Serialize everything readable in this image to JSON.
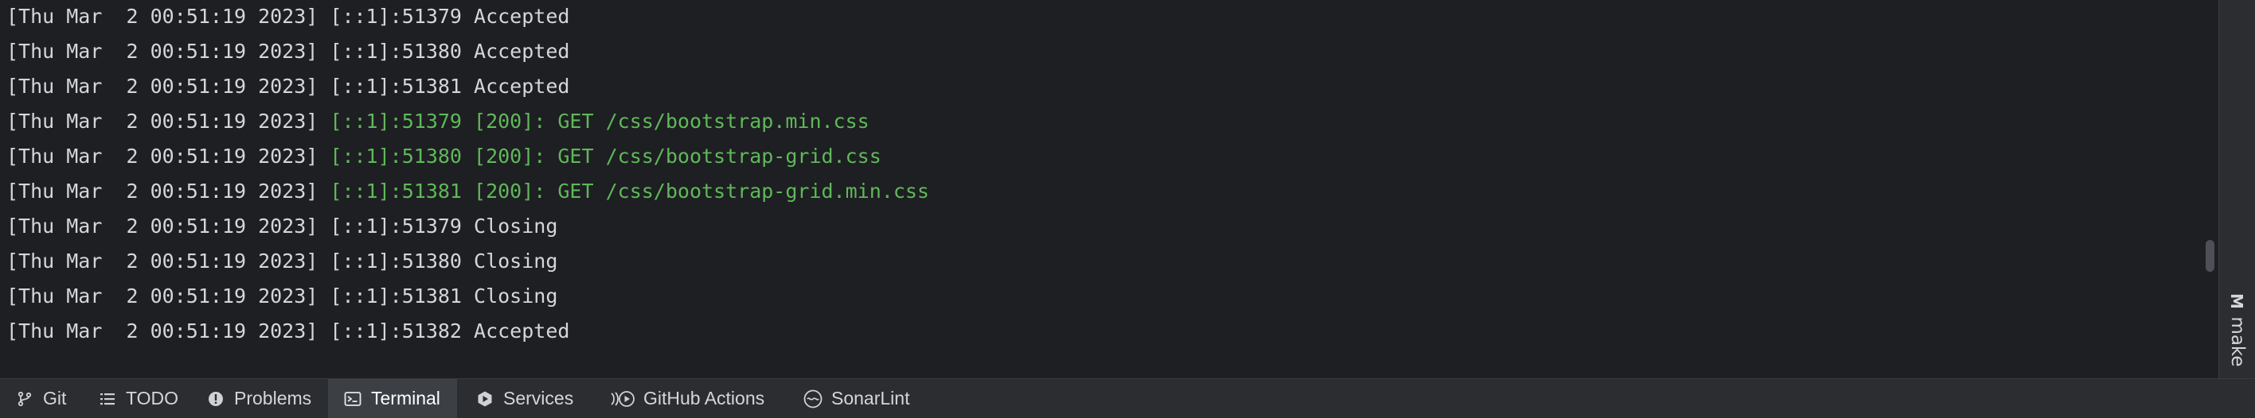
{
  "terminal": {
    "lines": [
      {
        "prefix": "[Thu Mar  2 00:51:19 2023]",
        "message": "[::1]:51379 Accepted",
        "style": "plain"
      },
      {
        "prefix": "[Thu Mar  2 00:51:19 2023]",
        "message": "[::1]:51380 Accepted",
        "style": "plain"
      },
      {
        "prefix": "[Thu Mar  2 00:51:19 2023]",
        "message": "[::1]:51381 Accepted",
        "style": "plain"
      },
      {
        "prefix": "[Thu Mar  2 00:51:19 2023]",
        "message": "[::1]:51379 [200]: GET /css/bootstrap.min.css",
        "style": "green"
      },
      {
        "prefix": "[Thu Mar  2 00:51:19 2023]",
        "message": "[::1]:51380 [200]: GET /css/bootstrap-grid.css",
        "style": "green"
      },
      {
        "prefix": "[Thu Mar  2 00:51:19 2023]",
        "message": "[::1]:51381 [200]: GET /css/bootstrap-grid.min.css",
        "style": "green"
      },
      {
        "prefix": "[Thu Mar  2 00:51:19 2023]",
        "message": "[::1]:51379 Closing",
        "style": "plain"
      },
      {
        "prefix": "[Thu Mar  2 00:51:19 2023]",
        "message": "[::1]:51380 Closing",
        "style": "plain"
      },
      {
        "prefix": "[Thu Mar  2 00:51:19 2023]",
        "message": "[::1]:51381 Closing",
        "style": "plain"
      },
      {
        "prefix": "[Thu Mar  2 00:51:19 2023]",
        "message": "[::1]:51382 Accepted",
        "style": "plain"
      }
    ]
  },
  "right_panel": {
    "make_icon": "M",
    "make_label": "make"
  },
  "toolwindow_bar": {
    "git": {
      "label": "Git",
      "icon": "git-branch-icon"
    },
    "todo": {
      "label": "TODO",
      "icon": "list-icon"
    },
    "problems": {
      "label": "Problems",
      "icon": "problems-icon"
    },
    "terminal": {
      "label": "Terminal",
      "icon": "terminal-icon",
      "active": true
    },
    "services": {
      "label": "Services",
      "icon": "services-play-icon"
    },
    "github_actions": {
      "label": "GitHub Actions",
      "icon": "github-actions-icon"
    },
    "sonarlint": {
      "label": "SonarLint",
      "icon": "sonarlint-icon"
    }
  },
  "colors": {
    "background": "#1e1f22",
    "text": "#d5d6d8",
    "success_green": "#5fb85a",
    "toolbar_bg": "#2b2d30",
    "active_tab_bg": "#3c3f44"
  }
}
